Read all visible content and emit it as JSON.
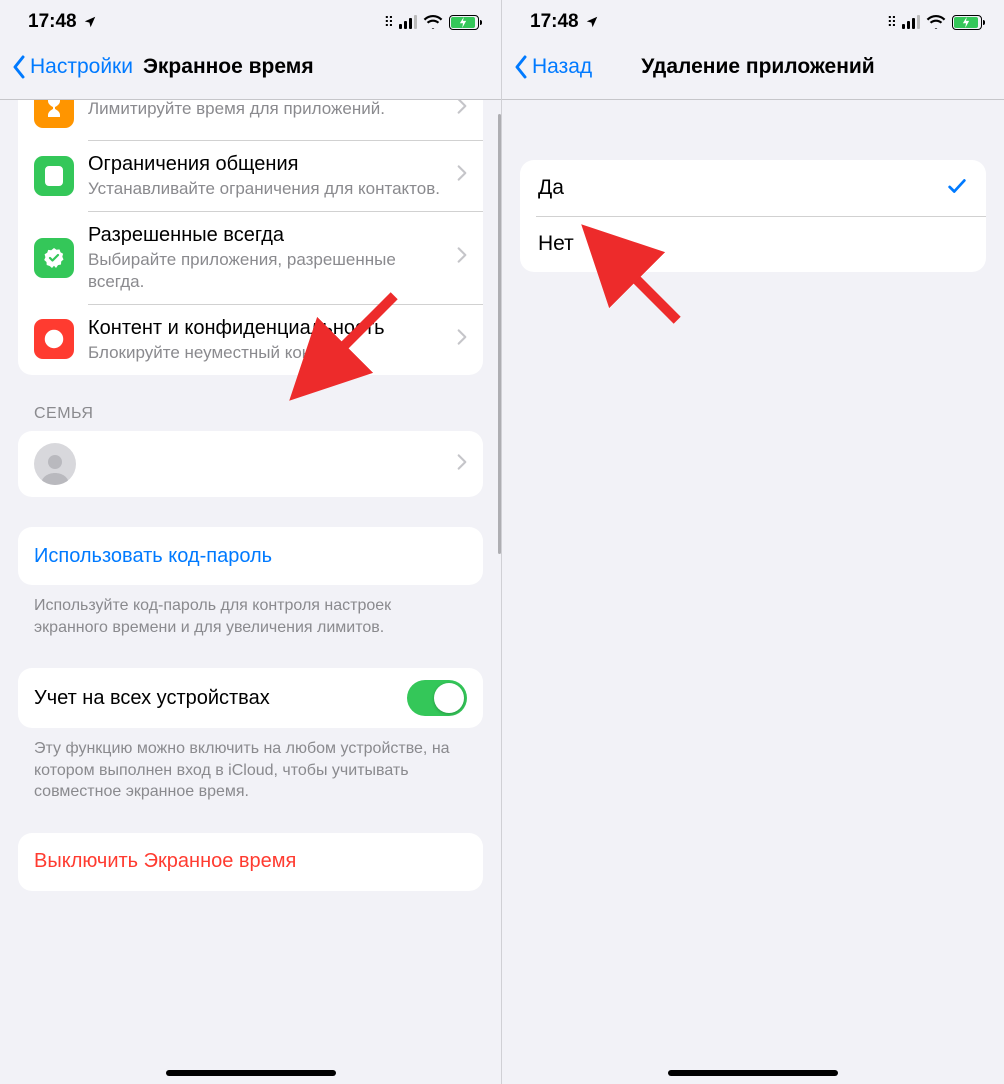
{
  "status": {
    "time": "17:48"
  },
  "left": {
    "back_label": "Настройки",
    "title": "Экранное время",
    "rows": {
      "limits": {
        "title": "",
        "sub": "Лимитируйте время для приложений."
      },
      "comm": {
        "title": "Ограничения общения",
        "sub": "Устанавливайте ограничения для контактов."
      },
      "allowed": {
        "title": "Разрешенные всегда",
        "sub": "Выбирайте приложения, разрешенные всегда."
      },
      "content": {
        "title": "Контент и конфиденциальность",
        "sub": "Блокируйте неуместный контент."
      }
    },
    "family_header": "СЕМЬЯ",
    "passcode_label": "Использовать код-пароль",
    "passcode_footer": "Используйте код-пароль для контроля настроек экранного времени и для увеличения лимитов.",
    "alldevices_label": "Учет на всех устройствах",
    "alldevices_footer": "Эту функцию можно включить на любом устройстве, на котором выполнен вход в iCloud, чтобы учитывать совместное экранное время.",
    "turnoff_label": "Выключить Экранное время"
  },
  "right": {
    "back_label": "Назад",
    "title": "Удаление приложений",
    "option_yes": "Да",
    "option_no": "Нет"
  }
}
